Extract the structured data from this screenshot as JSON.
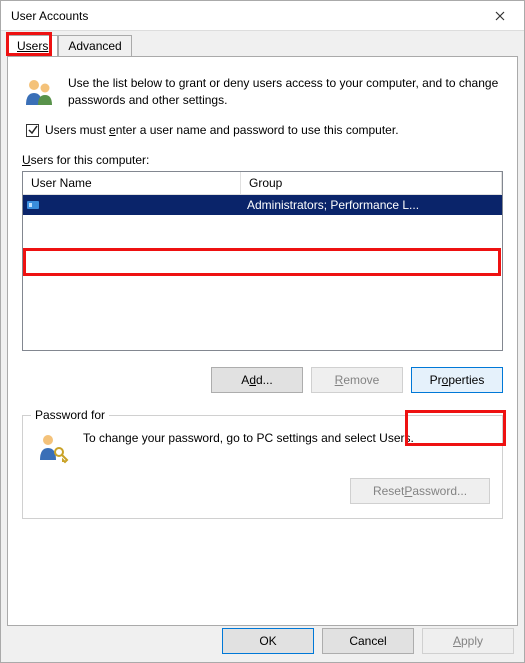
{
  "window": {
    "title": "User Accounts"
  },
  "tabs": {
    "users": "Users",
    "advanced": "Advanced"
  },
  "intro": "Use the list below to grant or deny users access to your computer, and to change passwords and other settings.",
  "checkbox_label_pre": "Users must ",
  "checkbox_label_u": "e",
  "checkbox_label_post": "nter a user name and password to use this computer.",
  "list_label_pre": "",
  "list_label_u": "U",
  "list_label_post": "sers for this computer:",
  "columns": {
    "c1": "User Name",
    "c2": "Group"
  },
  "row": {
    "username": "",
    "group": "Administrators; Performance L..."
  },
  "buttons": {
    "add_pre": "A",
    "add_u": "d",
    "add_post": "d...",
    "remove_pre": "",
    "remove_u": "R",
    "remove_post": "emove",
    "props_pre": "Pr",
    "props_u": "o",
    "props_post": "perties"
  },
  "pw_group": {
    "legend": "Password for",
    "text": "To change your password, go to PC settings and select Users.",
    "reset_pre": "Reset ",
    "reset_u": "P",
    "reset_post": "assword..."
  },
  "dialog_buttons": {
    "ok": "OK",
    "cancel": "Cancel",
    "apply_u": "A",
    "apply_post": "pply"
  }
}
